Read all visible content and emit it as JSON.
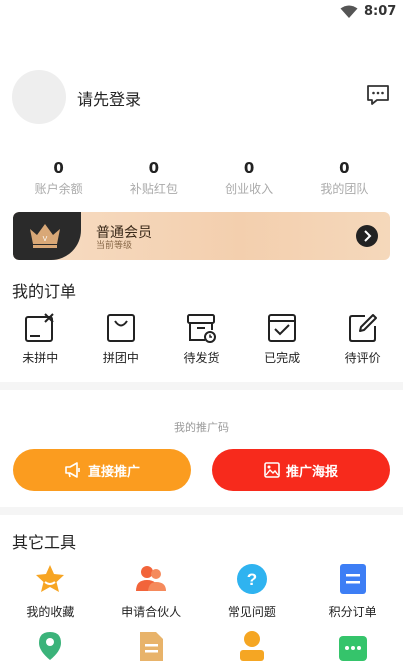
{
  "status_bar": {
    "time": "8:07"
  },
  "profile": {
    "login_prompt": "请先登录"
  },
  "stats": [
    {
      "value": "0",
      "label": "账户余额"
    },
    {
      "value": "0",
      "label": "补贴红包"
    },
    {
      "value": "0",
      "label": "创业收入"
    },
    {
      "value": "0",
      "label": "我的团队"
    }
  ],
  "member": {
    "title": "普通会员",
    "subtitle": "当前等级"
  },
  "orders": {
    "title": "我的订单",
    "items": [
      {
        "label": "未拼中",
        "icon": "unmatched-icon"
      },
      {
        "label": "拼团中",
        "icon": "bag-icon"
      },
      {
        "label": "待发货",
        "icon": "box-clock-icon"
      },
      {
        "label": "已完成",
        "icon": "check-box-icon"
      },
      {
        "label": "待评价",
        "icon": "edit-icon"
      }
    ]
  },
  "promo": {
    "title": "我的推广码",
    "direct_label": "直接推广",
    "poster_label": "推广海报"
  },
  "tools": {
    "title": "其它工具",
    "items": [
      {
        "label": "我的收藏",
        "icon": "star-icon",
        "color": "#f7a523"
      },
      {
        "label": "申请合伙人",
        "icon": "partners-icon",
        "color": "#f2643a"
      },
      {
        "label": "常见问题",
        "icon": "question-icon",
        "color": "#2fb3f0"
      },
      {
        "label": "积分订单",
        "icon": "list-icon",
        "color": "#3d7ef5"
      }
    ],
    "partial_row": [
      {
        "icon": "location-icon",
        "color": "#3bb37a"
      },
      {
        "icon": "document-icon",
        "color": "#e8b36a"
      },
      {
        "icon": "person-icon",
        "color": "#f5a623"
      },
      {
        "icon": "chat-icon",
        "color": "#35c46b"
      }
    ]
  }
}
